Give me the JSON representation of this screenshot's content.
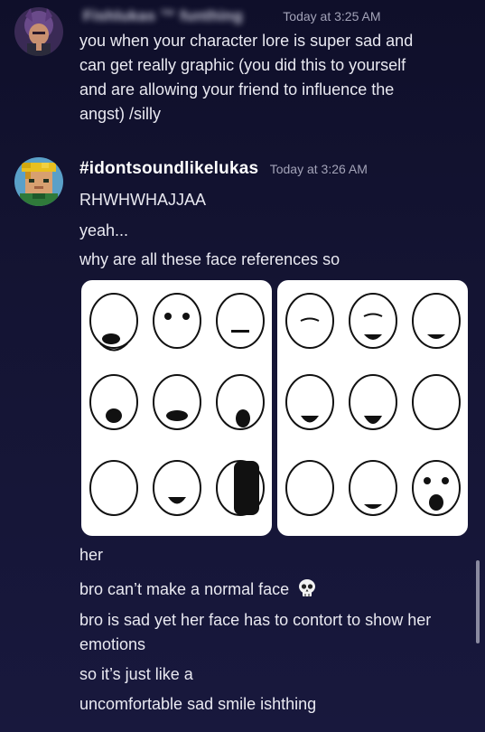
{
  "messages": [
    {
      "username": "Fishlukas ™ funthing",
      "timestamp": "Today at 3:25 AM",
      "lines": [
        "you when your character lore is super sad and",
        "can get really graphic (you did this to yourself",
        "and are allowing your friend to influence the",
        "angst) /silly"
      ]
    },
    {
      "username": "#idontsoundlikelukas",
      "timestamp": "Today at 3:26 AM",
      "lines": [
        "RHWHWHAJJAA",
        "yeah...",
        "why are all these face references so"
      ]
    }
  ],
  "followups": [
    "her",
    "bro can’t make a normal face",
    "bro is sad yet her face has to contort to show her",
    "emotions",
    "so it’s just like a",
    "uncomfortable sad smile ishthing"
  ],
  "icons": {
    "skull": "skull-emoji",
    "avatar1": "anime-character-avatar",
    "avatar2": "pixel-character-avatar"
  },
  "colors": {
    "background": "#141433",
    "text": "#e9e9f1",
    "timestamp": "#a3a3b8"
  }
}
